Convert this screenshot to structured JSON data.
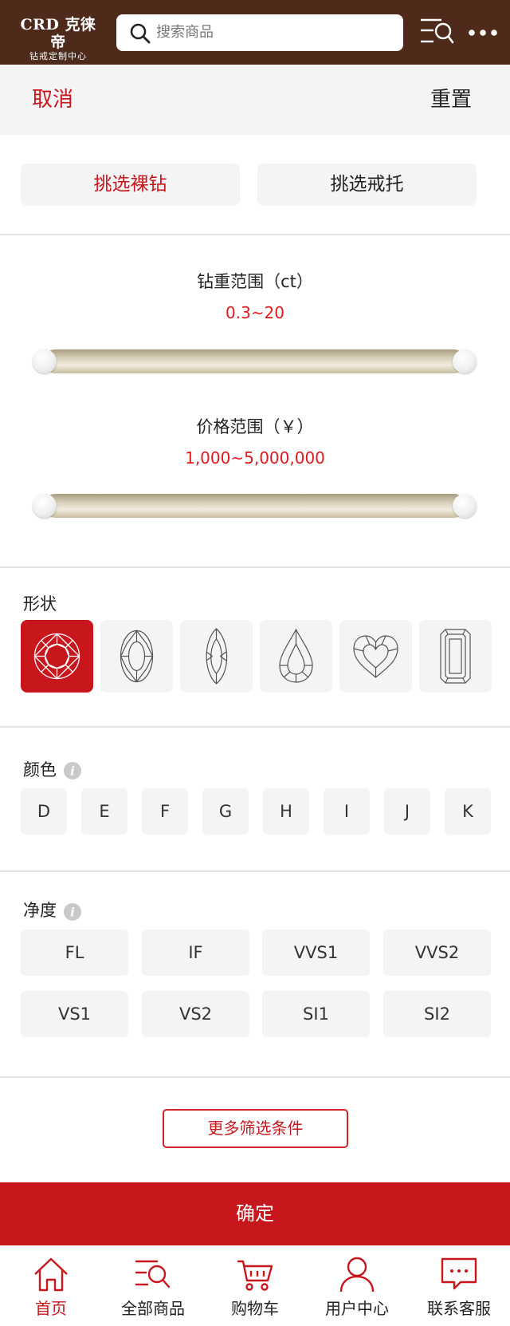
{
  "header": {
    "logo_main": "CRD 克徕帝",
    "logo_sub": "钻戒定制中心",
    "search_placeholder": "搜索商品",
    "icons": [
      "search-icon",
      "filter-list-icon",
      "more-dots-icon"
    ],
    "background_color": "#4e2a1b"
  },
  "actionbar": {
    "cancel_label": "取消",
    "reset_label": "重置"
  },
  "pick": {
    "diamond_label": "挑选裸钻",
    "mount_label": "挑选戒托",
    "active": "diamond"
  },
  "carat": {
    "title": "钻重范围（ct）",
    "value": "0.3~20",
    "min_fraction": 0,
    "max_fraction": 1
  },
  "price": {
    "title": "价格范围（￥）",
    "value": "1,000~5,000,000",
    "min_fraction": 0,
    "max_fraction": 1
  },
  "shape": {
    "label": "形状",
    "items": [
      "round-diamond-icon",
      "oval-diamond-icon",
      "marquise-diamond-icon",
      "pear-diamond-icon",
      "heart-diamond-icon",
      "emerald-diamond-icon"
    ],
    "selected": "round"
  },
  "color": {
    "label": "颜色",
    "options": [
      "D",
      "E",
      "F",
      "G",
      "H",
      "I",
      "J",
      "K"
    ]
  },
  "clarity": {
    "label": "净度",
    "options": [
      "FL",
      "IF",
      "VVS1",
      "VVS2",
      "VS1",
      "VS2",
      "SI1",
      "SI2"
    ]
  },
  "more_filters_label": "更多筛选条件",
  "confirm_label": "确定",
  "nav": {
    "items": [
      {
        "label": "首页",
        "icon": "home-icon"
      },
      {
        "label": "全部商品",
        "icon": "all-products-icon"
      },
      {
        "label": "购物车",
        "icon": "cart-icon"
      },
      {
        "label": "用户中心",
        "icon": "user-icon"
      },
      {
        "label": "联系客服",
        "icon": "chat-icon"
      }
    ],
    "active": "首页"
  },
  "colors": {
    "accent": "#c8161d",
    "value_red": "#e0191f",
    "panel_grey": "#f4f4f4"
  }
}
